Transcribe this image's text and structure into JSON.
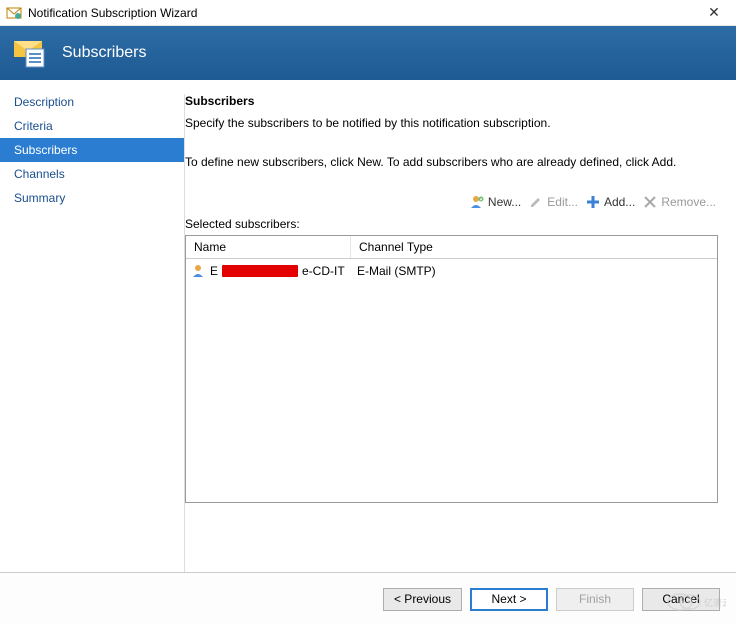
{
  "window": {
    "title": "Notification Subscription Wizard"
  },
  "banner": {
    "title": "Subscribers"
  },
  "sidebar": {
    "items": [
      {
        "label": "Description"
      },
      {
        "label": "Criteria"
      },
      {
        "label": "Subscribers"
      },
      {
        "label": "Channels"
      },
      {
        "label": "Summary"
      }
    ],
    "active_index": 2
  },
  "content": {
    "heading": "Subscribers",
    "description": "Specify the subscribers to be notified by this notification subscription.",
    "help": "To define new subscribers, click New.  To add subscribers who are already defined, click Add.",
    "toolbar": {
      "new": "New...",
      "edit": "Edit...",
      "add": "Add...",
      "remove": "Remove..."
    },
    "list_label": "Selected subscribers:",
    "columns": {
      "name": "Name",
      "channel_type": "Channel Type"
    },
    "rows": [
      {
        "name_prefix": "E",
        "name_suffix": "e-CD-IT",
        "channel_type": "E-Mail (SMTP)"
      }
    ]
  },
  "footer": {
    "previous": "< Previous",
    "next": "Next >",
    "finish": "Finish",
    "cancel": "Cancel"
  },
  "watermark": "亿速云"
}
